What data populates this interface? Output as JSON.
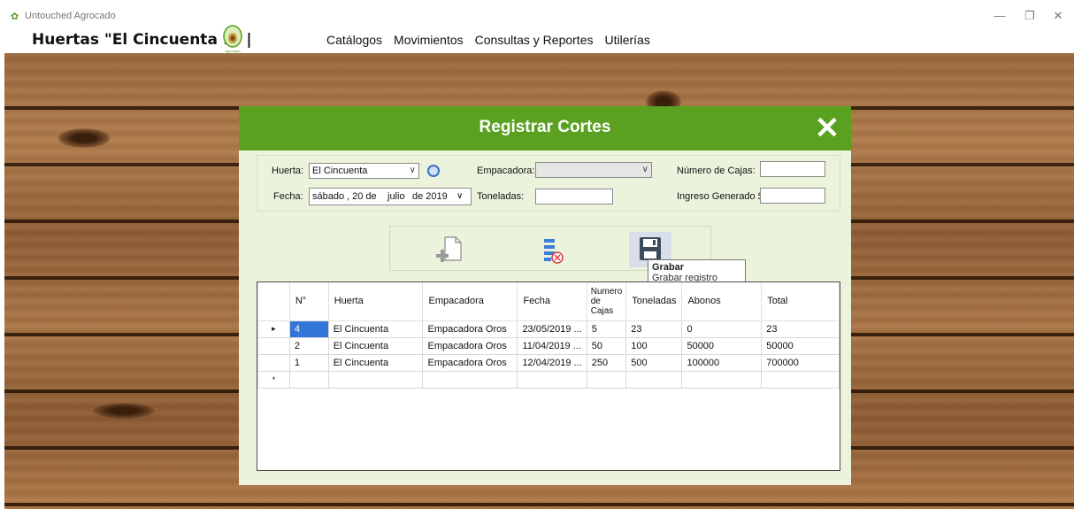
{
  "window": {
    "title": "Untouched Agrocado",
    "minimize_icon": "minimize-icon",
    "maximize_icon": "maximize-icon",
    "close_icon": "close-icon"
  },
  "header": {
    "brand": "Huertas \"El Cincuenta 1\" |",
    "menu": [
      "Catálogos",
      "Movimientos",
      "Consultas y Reportes",
      "Utilerías"
    ]
  },
  "dialog": {
    "title": "Registrar Cortes",
    "form": {
      "huerta_label": "Huerta:",
      "huerta_value": "El Cincuenta",
      "fecha_label": "Fecha:",
      "fecha_weekday": "sábado",
      "fecha_day": ", 20 de",
      "fecha_month": "julio",
      "fecha_year": "de 2019",
      "empacadora_label": "Empacadora:",
      "empacadora_value": "",
      "toneladas_label": "Toneladas:",
      "toneladas_value": "",
      "cajas_label": "Número de Cajas:",
      "cajas_value": "",
      "ingreso_label": "Ingreso Generado $",
      "ingreso_value": ""
    },
    "toolbar": {
      "tooltip_title": "Grabar",
      "tooltip_text": "Grabar registro actual"
    },
    "grid": {
      "columns": [
        "N°",
        "Huerta",
        "Empacadora",
        "Fecha",
        "Numero de Cajas",
        "Toneladas",
        "Abonos",
        "Total"
      ],
      "rows": [
        {
          "n": "4",
          "huerta": "El Cincuenta",
          "empacadora": "Empacadora Oros",
          "fecha": "23/05/2019 ...",
          "cajas": "5",
          "toneladas": "23",
          "abonos": "0",
          "total": "23"
        },
        {
          "n": "2",
          "huerta": "El Cincuenta",
          "empacadora": "Empacadora Oros",
          "fecha": "11/04/2019 ...",
          "cajas": "50",
          "toneladas": "100",
          "abonos": "50000",
          "total": "50000"
        },
        {
          "n": "1",
          "huerta": "El Cincuenta",
          "empacadora": "Empacadora Oros",
          "fecha": "12/04/2019 ...",
          "cajas": "250",
          "toneladas": "500",
          "abonos": "100000",
          "total": "700000"
        }
      ],
      "current_row_marker": "▸",
      "new_row_marker": "*"
    }
  },
  "colors": {
    "header_green": "#5aa021",
    "dialog_bg": "#ebf3dc",
    "selection_blue": "#3276d8"
  }
}
